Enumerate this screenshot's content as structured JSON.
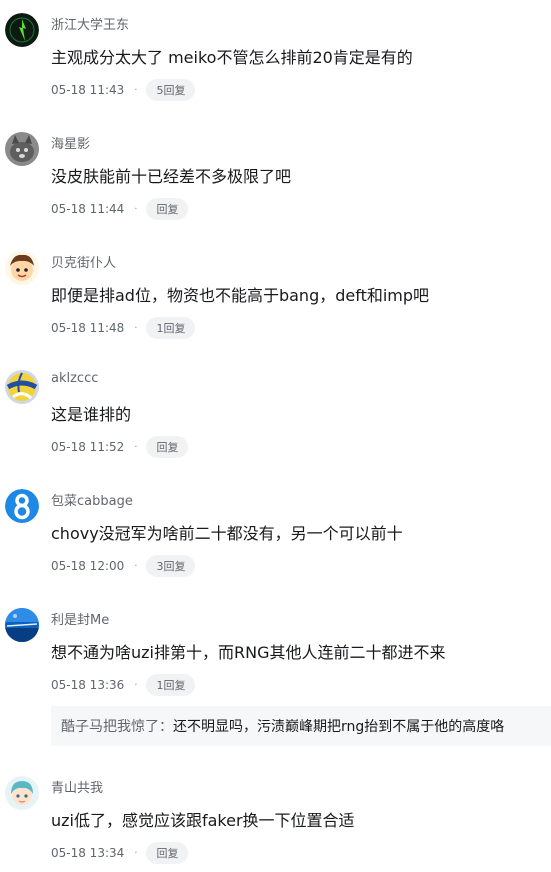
{
  "comments": [
    {
      "username": "浙江大学王东",
      "content": "主观成分太大了 meiko不管怎么排前20肯定是有的",
      "time": "05-18 11:43",
      "dot": "·",
      "reply_label": "5回复",
      "avatar_icon": "dark-flame-avatar-icon"
    },
    {
      "username": "海星影",
      "content": "没皮肤能前十已经差不多极限了吧",
      "time": "05-18 11:44",
      "dot": "·",
      "reply_label": "回复",
      "avatar_icon": "cat-avatar-icon"
    },
    {
      "username": "贝克街仆人",
      "content": "即便是排ad位，物资也不能高于bang，deft和imp吧",
      "time": "05-18 11:48",
      "dot": "·",
      "reply_label": "1回复",
      "avatar_icon": "cartoon-boy-avatar-icon"
    },
    {
      "username": "aklzccc",
      "content": "这是谁排的",
      "time": "05-18 11:52",
      "dot": "·",
      "reply_label": "回复",
      "avatar_icon": "volleyball-avatar-icon"
    },
    {
      "username": "包菜cabbage",
      "content": "chovy没冠军为啥前二十都没有，另一个可以前十",
      "time": "05-18 12:00",
      "dot": "·",
      "reply_label": "3回复",
      "avatar_icon": "blue-eight-avatar-icon"
    },
    {
      "username": "利是封Me",
      "content": "想不通为啥uzi排第十，而RNG其他人连前二十都进不来",
      "time": "05-18 13:36",
      "dot": "·",
      "reply_label": "1回复",
      "avatar_icon": "blue-sky-avatar-icon"
    },
    {
      "username": "青山共我",
      "content": "uzi低了，感觉应该跟faker换一下位置合适",
      "time": "05-18 13:34",
      "dot": "·",
      "reply_label": "回复",
      "avatar_icon": "anime-character-avatar-icon"
    }
  ],
  "sub_reply": {
    "username": "酷子马把我惊了：",
    "content": "还不明显吗，污渍巅峰期把rng抬到不属于他的高度咯"
  },
  "colors": {
    "username": "#61666d",
    "content": "#18191c",
    "meta": "#61666d",
    "reply_bg": "#f1f2f3",
    "sub_reply_bg": "#f6f7f8"
  }
}
